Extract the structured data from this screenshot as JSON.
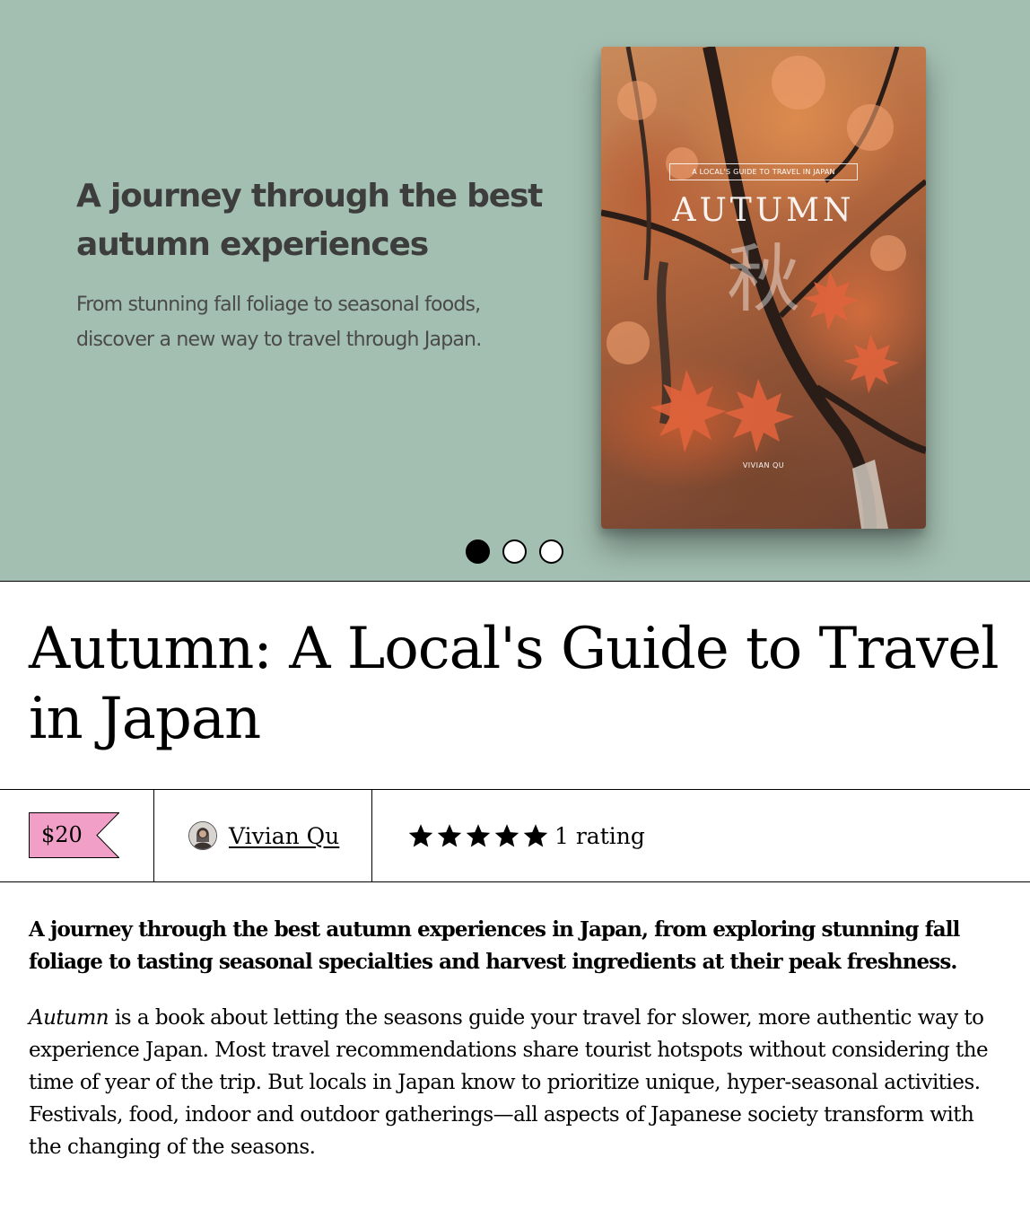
{
  "hero": {
    "heading": "A journey through the best autumn experiences",
    "subheading": "From stunning fall foliage to seasonal foods, discover a new way to travel through Japan.",
    "background_color": "#a3bfb1",
    "book_cover": {
      "tagline": "A LOCAL'S GUIDE TO TRAVEL IN JAPAN",
      "title": "AUTUMN",
      "kanji": "秋",
      "author": "VIVIAN QU"
    },
    "carousel": {
      "slide_count": 3,
      "active_index": 0
    }
  },
  "product": {
    "title": "Autumn: A Local's Guide to Travel in Japan",
    "price": "$20",
    "price_tag_color": "#f19fc7",
    "author_name": "Vivian Qu",
    "rating": {
      "stars": 5,
      "text": "1 rating"
    }
  },
  "description": {
    "lead": "A journey through the best autumn experiences in Japan, from exploring stunning fall foliage to tasting seasonal specialties and harvest ingredients at their peak freshness.",
    "body_italic": "Autumn",
    "body_rest": " is a book about letting the seasons guide your travel for slower, more authentic way to experience Japan. Most travel recommendations share tourist hotspots without considering the time of year of the trip. But locals in Japan know to prioritize unique, hyper-seasonal activities. Festivals, food, indoor and outdoor gatherings—all aspects of Japanese society transform with the changing of the seasons."
  }
}
